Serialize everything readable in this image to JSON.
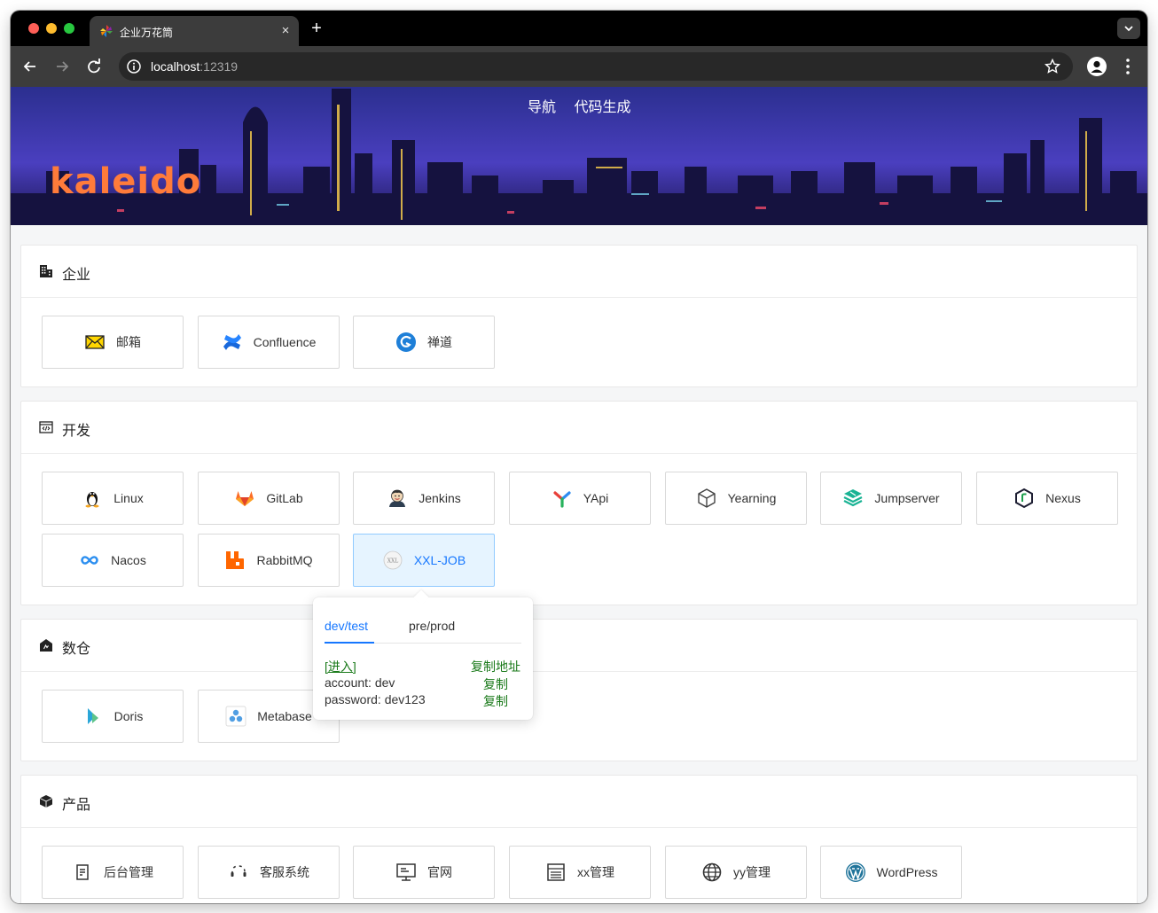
{
  "browser": {
    "tab_title": "企业万花筒",
    "tab_close": "×",
    "new_tab": "+",
    "url_host": "localhost",
    "url_port": ":12319"
  },
  "header": {
    "nav": [
      "导航",
      "代码生成"
    ],
    "logo_text": "kaleido"
  },
  "sections": [
    {
      "title": "企业",
      "icon": "building-icon",
      "items": [
        {
          "label": "邮箱",
          "icon": "mail-icon"
        },
        {
          "label": "Confluence",
          "icon": "confluence-icon"
        },
        {
          "label": "禅道",
          "icon": "zentao-icon"
        }
      ]
    },
    {
      "title": "开发",
      "icon": "code-window-icon",
      "items": [
        {
          "label": "Linux",
          "icon": "linux-icon"
        },
        {
          "label": "GitLab",
          "icon": "gitlab-icon"
        },
        {
          "label": "Jenkins",
          "icon": "jenkins-icon"
        },
        {
          "label": "YApi",
          "icon": "yapi-icon"
        },
        {
          "label": "Yearning",
          "icon": "cube-icon"
        },
        {
          "label": "Jumpserver",
          "icon": "jumpserver-icon"
        },
        {
          "label": "Nexus",
          "icon": "nexus-icon"
        },
        {
          "label": "Nacos",
          "icon": "nacos-icon"
        },
        {
          "label": "RabbitMQ",
          "icon": "rabbitmq-icon"
        },
        {
          "label": "XXL-JOB",
          "icon": "xxl-job-icon"
        }
      ]
    },
    {
      "title": "数仓",
      "icon": "warehouse-icon",
      "items": [
        {
          "label": "Doris",
          "icon": "doris-icon"
        },
        {
          "label": "Metabase",
          "icon": "metabase-icon"
        }
      ]
    },
    {
      "title": "产品",
      "icon": "box-icon",
      "items": [
        {
          "label": "后台管理",
          "icon": "admin-icon"
        },
        {
          "label": "客服系统",
          "icon": "headset-icon"
        },
        {
          "label": "官网",
          "icon": "monitor-icon"
        },
        {
          "label": "xx管理",
          "icon": "list-icon"
        },
        {
          "label": "yy管理",
          "icon": "globe-icon"
        },
        {
          "label": "WordPress",
          "icon": "wordpress-icon"
        }
      ]
    }
  ],
  "popover": {
    "tabs": [
      "dev/test",
      "pre/prod"
    ],
    "enter_label": "[进入]",
    "copy_address_label": "复制地址",
    "account_text": "account: dev",
    "password_text": "password: dev123",
    "copy_label": "复制"
  },
  "colors": {
    "accent": "#1677ff",
    "logo": "#ff7b3a",
    "link_green": "#1a7a1a"
  }
}
